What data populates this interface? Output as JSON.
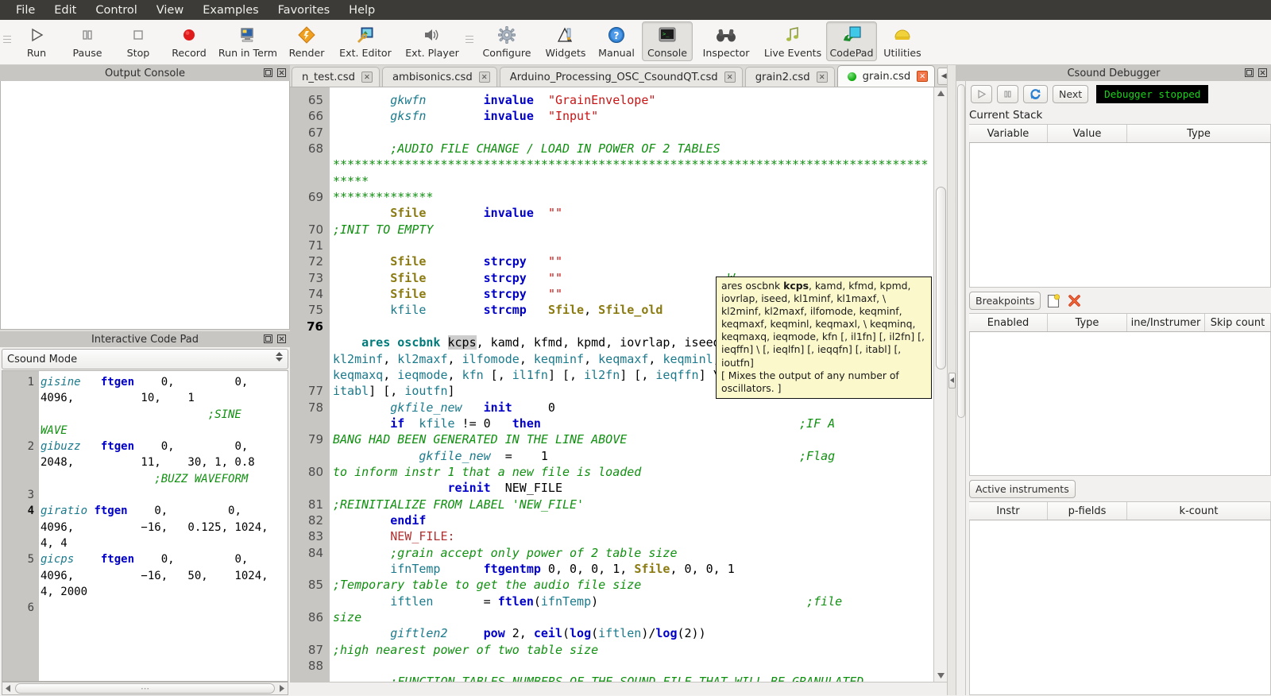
{
  "menubar": {
    "items": [
      {
        "label": "File"
      },
      {
        "label": "Edit"
      },
      {
        "label": "Control"
      },
      {
        "label": "View"
      },
      {
        "label": "Examples"
      },
      {
        "label": "Favorites"
      },
      {
        "label": "Help"
      }
    ]
  },
  "toolbar": {
    "buttons": [
      {
        "label": "Run",
        "icon": "play-icon",
        "active": false
      },
      {
        "label": "Pause",
        "icon": "pause-icon",
        "active": false
      },
      {
        "label": "Stop",
        "icon": "stop-icon",
        "active": false
      },
      {
        "label": "Record",
        "icon": "record-icon",
        "active": false
      },
      {
        "label": "Run in Term",
        "icon": "terminal-monitor-icon",
        "active": false
      },
      {
        "label": "Render",
        "icon": "render-diamond-icon",
        "active": false
      },
      {
        "label": "Ext. Editor",
        "icon": "external-editor-icon",
        "active": false
      },
      {
        "label": "Ext. Player",
        "icon": "speaker-icon",
        "active": false
      },
      {
        "label": "Configure",
        "icon": "gear-icon",
        "active": false
      },
      {
        "label": "Widgets",
        "icon": "widgets-pencil-icon",
        "active": false
      },
      {
        "label": "Manual",
        "icon": "help-question-icon",
        "active": false
      },
      {
        "label": "Console",
        "icon": "console-icon",
        "active": true
      },
      {
        "label": "Inspector",
        "icon": "binoculars-icon",
        "active": false
      },
      {
        "label": "Live Events",
        "icon": "music-note-icon",
        "active": false
      },
      {
        "label": "CodePad",
        "icon": "codepad-icon",
        "active": true
      },
      {
        "label": "Utilities",
        "icon": "utilities-icon",
        "active": false
      }
    ]
  },
  "output_console": {
    "title": "Output Console",
    "text": ""
  },
  "codepad": {
    "title": "Interactive Code Pad",
    "mode": "Csound Mode",
    "line_numbers": [
      "1",
      "2",
      "3",
      "4",
      "5",
      "6"
    ],
    "current_line": "4",
    "lines": [
      {
        "n": "1",
        "text": "gisine   ftgen    0,         0,     4096,          10,    1                       ;SINE WAVE"
      },
      {
        "n": "2",
        "text": "gibuzz   ftgen    0,         0,     2048,          11,    30, 1, 0.8          ;BUZZ WAVEFORM"
      },
      {
        "n": "3",
        "text": ""
      },
      {
        "n": "4",
        "text": "giratio  ftgen    0,         0,     4096,          -16,   0.125, 1024, 4, 4"
      },
      {
        "n": "5",
        "text": "gicps    ftgen    0,         0,     4096,          -16,   50,    1024, 4, 2000"
      },
      {
        "n": "6",
        "text": ""
      }
    ]
  },
  "tabs": {
    "items": [
      {
        "label": "n_test.csd",
        "selected": false,
        "modified": false
      },
      {
        "label": "ambisonics.csd",
        "selected": false,
        "modified": false
      },
      {
        "label": "Arduino_Processing_OSC_CsoundQT.csd",
        "selected": false,
        "modified": false
      },
      {
        "label": "grain2.csd",
        "selected": false,
        "modified": false
      },
      {
        "label": "grain.csd",
        "selected": true,
        "modified": true
      }
    ],
    "nav_prev": "◀",
    "nav_next": "▶"
  },
  "editor": {
    "line_numbers": [
      "65",
      "66",
      "67",
      "68",
      "69",
      "70",
      "71",
      "72",
      "73",
      "74",
      "75",
      "76",
      "77",
      "78",
      "79",
      "80",
      "81",
      "82",
      "83",
      "84",
      "85",
      "86",
      "87",
      "88"
    ],
    "highlighted_line": "76",
    "visible_code": "        gkwfn        invalue  \"GrainEnvelope\"\n        gksfn        invalue  \"Input\"\n\n        ;AUDIO FILE CHANGE / LOAD IN POWER OF 2 TABLES ********************************************************************\n        Sfile        invalue  \"\"        ;INIT TO EMPTY\n\n        Sfile ...\n        Sfile ...                                   W\n        Sfile ...\n        kfile ...                            file_old\n\n    ares oscbnk kcps, kamd, kfmd, kpmd, iovrlap, iseed, kl1minf, kl1maxf, \\ kl2minf, kl2maxf, ilfomode, keqminf, keqmaxf, keqminl, keqmaxl, \\ keqminq, keqmaxq, ieqmode, kfn [, il1fn] [, il2fn] [, ieqffn] \\ [, ieqlfn] [, ieqqfn] [, itabl] [, ioutfn]\n        gkfile_new   init     0\n        if  kfile != 0   then                                    ;IF A BANG HAD BEEN GENERATED IN THE LINE ABOVE\n            gkfile_new  =    1                                   ;Flag to inform instr 1 that a new file is loaded\n                reinit  NEW_FILE                                 ;REINITIALIZE FROM LABEL 'NEW_FILE'\n        endif\n        NEW_FILE:\n        ;grain accept only power of 2 table size\n        ifnTemp      ftgentmp 0, 0, 0, 1, Sfile, 0, 0, 1         ;Temporary table to get the audio file size\n        iftlen       = ftlen(ifnTemp)                            ;file size\n        giftlen2     pow 2, ceil(log(iftlen)/log(2))             ;high nearest power of two table size\n\n        ;FUNCTION TABLES NUMBERS OF THE SOUND FILE THAT WILL BE GRANULATED",
    "selected_token": "kcps"
  },
  "tooltip": {
    "signature_prefix": "ares oscbnk ",
    "signature_bold": "kcps",
    "signature_rest": ", kamd, kfmd, kpmd, iovrlap, iseed, kl1minf, kl1maxf, \\ kl2minf, kl2maxf, ilfomode, keqminf, keqmaxf, keqminl, keqmaxl, \\ keqminq, keqmaxq, ieqmode, kfn [, il1fn] [, il2fn] [, ieqffn] \\ [, ieqlfn] [, ieqqfn] [, itabl] [, ioutfn]",
    "description": "[ Mixes the output of any number of oscillators. ]"
  },
  "debugger": {
    "title": "Csound Debugger",
    "buttons": {
      "play": "▷",
      "pause": "▮▮",
      "refresh": "⟳",
      "next": "Next"
    },
    "status": "Debugger stopped",
    "current_stack_label": "Current Stack",
    "stack_columns": [
      "Variable",
      "Value",
      "Type"
    ],
    "stack_rows": [],
    "breakpoints_label": "Breakpoints",
    "breakpoint_columns": [
      "Enabled",
      "Type",
      "ine/Instrumer",
      "Skip count"
    ],
    "breakpoint_rows": [],
    "active_instruments_label": "Active instruments",
    "instrument_columns": [
      "Instr",
      "p-fields",
      "k-count"
    ],
    "instrument_rows": []
  },
  "colors": {
    "menubar_bg": "#3c3b37",
    "toolbar_bg": "#f6f5f4",
    "dock_title_bg": "#c8c6c3",
    "tooltip_bg": "#fbf8cc",
    "status_green": "#19d219",
    "keyword_blue": "#0000c8",
    "comment_green": "#109010",
    "string_red": "#c81414",
    "opcode_teal": "#007a7a",
    "accent_orange": "#f3764a"
  }
}
